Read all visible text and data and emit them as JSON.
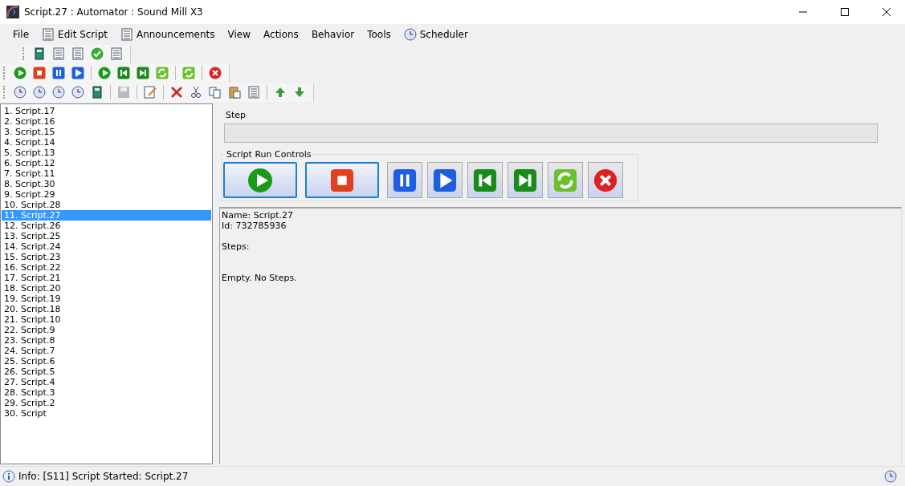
{
  "window": {
    "title": "Script.27 : Automator : Sound Mill X3"
  },
  "menu": [
    {
      "label": "File",
      "icon": false
    },
    {
      "label": "Edit Script",
      "icon": true
    },
    {
      "label": "Announcements",
      "icon": true
    },
    {
      "label": "View",
      "icon": false
    },
    {
      "label": "Actions",
      "icon": false
    },
    {
      "label": "Behavior",
      "icon": false
    },
    {
      "label": "Tools",
      "icon": false
    },
    {
      "label": "Scheduler",
      "icon": true
    }
  ],
  "scripts": [
    {
      "label": "1. Script.17",
      "selected": false
    },
    {
      "label": "2. Script.16",
      "selected": false
    },
    {
      "label": "3. Script.15",
      "selected": false
    },
    {
      "label": "4. Script.14",
      "selected": false
    },
    {
      "label": "5. Script.13",
      "selected": false
    },
    {
      "label": "6. Script.12",
      "selected": false
    },
    {
      "label": "7. Script.11",
      "selected": false
    },
    {
      "label": "8. Script.30",
      "selected": false
    },
    {
      "label": "9. Script.29",
      "selected": false
    },
    {
      "label": "10. Script.28",
      "selected": false
    },
    {
      "label": "11. Script.27",
      "selected": true
    },
    {
      "label": "12. Script.26",
      "selected": false
    },
    {
      "label": "13. Script.25",
      "selected": false
    },
    {
      "label": "14. Script.24",
      "selected": false
    },
    {
      "label": "15. Script.23",
      "selected": false
    },
    {
      "label": "16. Script.22",
      "selected": false
    },
    {
      "label": "17. Script.21",
      "selected": false
    },
    {
      "label": "18. Script.20",
      "selected": false
    },
    {
      "label": "19. Script.19",
      "selected": false
    },
    {
      "label": "20. Script.18",
      "selected": false
    },
    {
      "label": "21. Script.10",
      "selected": false
    },
    {
      "label": "22. Script.9",
      "selected": false
    },
    {
      "label": "23. Script.8",
      "selected": false
    },
    {
      "label": "24. Script.7",
      "selected": false
    },
    {
      "label": "25. Script.6",
      "selected": false
    },
    {
      "label": "26. Script.5",
      "selected": false
    },
    {
      "label": "27. Script.4",
      "selected": false
    },
    {
      "label": "28. Script.3",
      "selected": false
    },
    {
      "label": "29. Script.2",
      "selected": false
    },
    {
      "label": "30. Script",
      "selected": false
    }
  ],
  "step": {
    "label": "Step"
  },
  "run_controls": {
    "title": "Script Run Controls"
  },
  "details": {
    "name": "Name: Script.27",
    "id": "Id: 732785936",
    "steps_label": "Steps:",
    "steps_message": "Empty. No Steps."
  },
  "status_bar": {
    "text": "Info: [S11] Script Started: Script.27"
  }
}
